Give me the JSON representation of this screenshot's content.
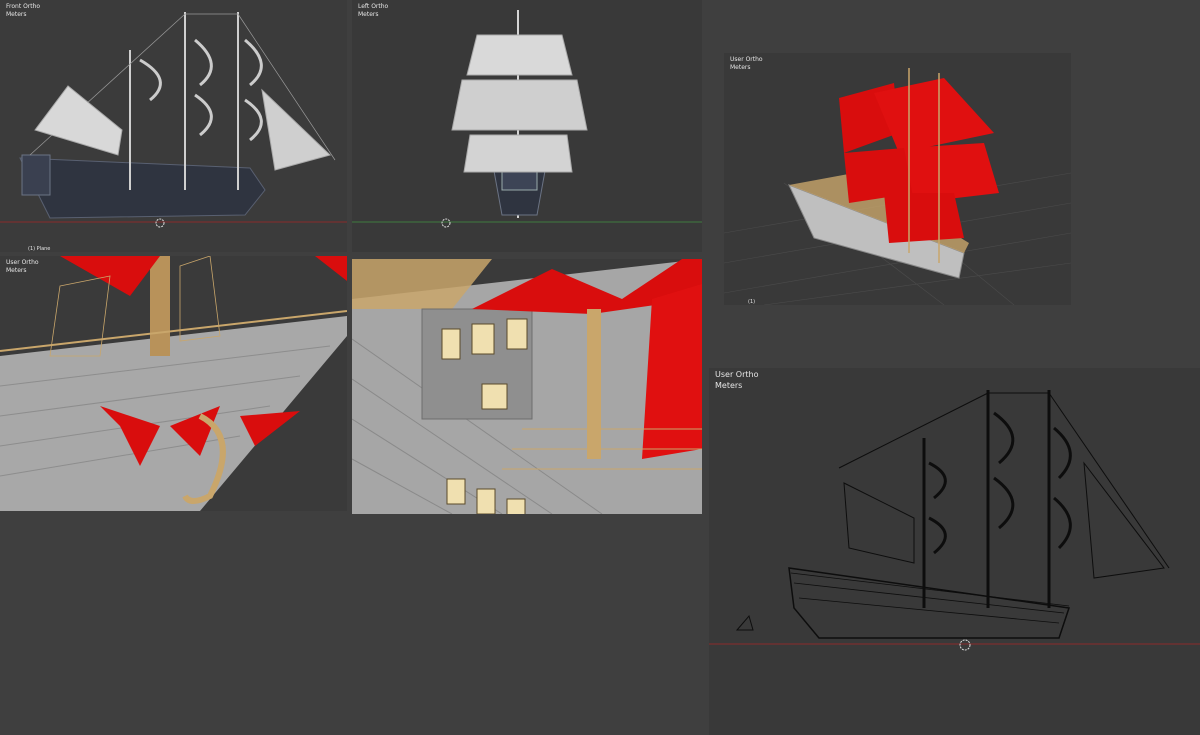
{
  "viewports": {
    "front": {
      "view": "Front Ortho",
      "units": "Meters",
      "footer": "(1) Plane"
    },
    "left": {
      "view": "Left Ortho",
      "units": "Meters"
    },
    "user_small": {
      "view": "User Ortho",
      "units": "Meters",
      "footer": "(1)"
    },
    "user_closeup": {
      "view": "User Ortho",
      "units": "Meters"
    },
    "user_wire": {
      "view": "User Ortho",
      "units": "Meters"
    }
  },
  "colors": {
    "background": "#3f3f3f",
    "viewport": "#393939",
    "sail_red": "#d90d0d",
    "wood": "#c9a66b",
    "hull_dark": "#2f3440"
  }
}
